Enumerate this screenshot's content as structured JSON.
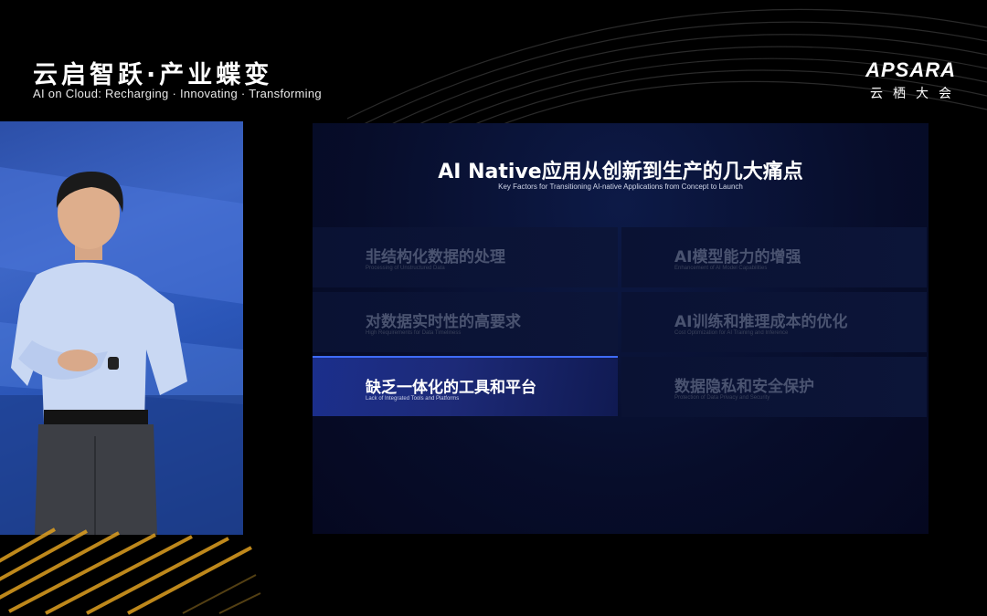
{
  "event": {
    "title": "云启智跃·产业蝶变",
    "subtitle": "AI on Cloud: Recharging · Innovating · Transforming"
  },
  "logo": {
    "name": "APSARA",
    "chinese": "云栖大会"
  },
  "slide": {
    "title": "AI Native应用从创新到生产的几大痛点",
    "subtitle": "Key Factors for Transitioning AI-native Applications from Concept to Launch",
    "items": [
      {
        "zh": "非结构化数据的处理",
        "en": "Processing of Unstructured Data",
        "active": false
      },
      {
        "zh": "AI模型能力的增强",
        "en": "Enhancement of AI Model Capabilities",
        "active": false
      },
      {
        "zh": "对数据实时性的高要求",
        "en": "High Requirements for Data Timeliness",
        "active": false
      },
      {
        "zh": "AI训练和推理成本的优化",
        "en": "Cost Optimization for AI Training and Inference",
        "active": false
      },
      {
        "zh": "缺乏一体化的工具和平台",
        "en": "Lack of Integrated Tools and Platforms",
        "active": true
      },
      {
        "zh": "数据隐私和安全保护",
        "en": "Protection of Data Privacy and Security",
        "active": false
      }
    ]
  },
  "colors": {
    "accent": "#3f6cff",
    "gold": "#e0a020",
    "slide_bg": "#070d2a"
  }
}
